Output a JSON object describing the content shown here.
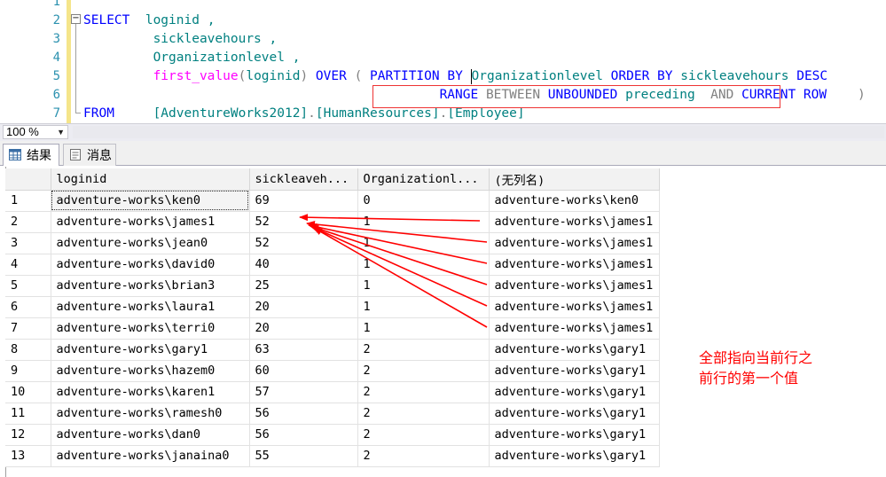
{
  "editor": {
    "line_numbers": [
      "1",
      "2",
      "3",
      "4",
      "5",
      "6",
      "7"
    ],
    "lines": [
      {
        "num": "1",
        "tokens": []
      },
      {
        "num": "2",
        "tokens": [
          {
            "t": "SELECT",
            "c": "kw"
          },
          {
            "t": "  loginid ,",
            "c": "id"
          }
        ]
      },
      {
        "num": "3",
        "tokens": [
          {
            "t": "         sickleavehours ,",
            "c": "id"
          }
        ]
      },
      {
        "num": "4",
        "tokens": [
          {
            "t": "         Organizationlevel ,",
            "c": "id"
          }
        ]
      },
      {
        "num": "5",
        "tokens": [
          {
            "t": "         first_value",
            "c": "fn"
          },
          {
            "t": "(",
            "c": "gr"
          },
          {
            "t": "loginid",
            "c": "id"
          },
          {
            "t": ")",
            "c": "gr"
          },
          {
            "t": " OVER ",
            "c": "kw"
          },
          {
            "t": "( ",
            "c": "gr"
          },
          {
            "t": "PARTITION BY ",
            "c": "kw"
          },
          {
            "t": "|",
            "c": "cursor"
          },
          {
            "t": "Organizationlevel",
            "c": "id"
          },
          {
            "t": " ORDER BY ",
            "c": "kw"
          },
          {
            "t": "sickleavehours",
            "c": "id"
          },
          {
            "t": " DESC",
            "c": "kw"
          }
        ]
      },
      {
        "num": "6",
        "tokens": [
          {
            "t": "                                              RANGE ",
            "c": "kw"
          },
          {
            "t": "BETWEEN ",
            "c": "gr"
          },
          {
            "t": "UNBOUNDED ",
            "c": "kw"
          },
          {
            "t": "preceding  ",
            "c": "id"
          },
          {
            "t": "AND ",
            "c": "gr"
          },
          {
            "t": "CURRENT ROW",
            "c": "kw"
          },
          {
            "t": "    )",
            "c": "gr"
          }
        ]
      },
      {
        "num": "7",
        "tokens": [
          {
            "t": "FROM",
            "c": "kw"
          },
          {
            "t": "     [AdventureWorks2012]",
            "c": "id"
          },
          {
            "t": ".",
            "c": "gr"
          },
          {
            "t": "[HumanResources]",
            "c": "id"
          },
          {
            "t": ".",
            "c": "gr"
          },
          {
            "t": "[Employee]",
            "c": "id"
          }
        ]
      }
    ]
  },
  "statusbar": {
    "zoom": "100 %"
  },
  "tabs": [
    {
      "label": "结果",
      "icon": "grid-icon",
      "active": true
    },
    {
      "label": "消息",
      "icon": "message-icon",
      "active": false
    }
  ],
  "grid": {
    "columns": [
      "loginid",
      "sickleaveh...",
      "Organizationl...",
      "(无列名)"
    ],
    "rows": [
      [
        "1",
        "adventure-works\\ken0",
        "69",
        "0",
        "adventure-works\\ken0"
      ],
      [
        "2",
        "adventure-works\\james1",
        "52",
        "1",
        "adventure-works\\james1"
      ],
      [
        "3",
        "adventure-works\\jean0",
        "52",
        "1",
        "adventure-works\\james1"
      ],
      [
        "4",
        "adventure-works\\david0",
        "40",
        "1",
        "adventure-works\\james1"
      ],
      [
        "5",
        "adventure-works\\brian3",
        "25",
        "1",
        "adventure-works\\james1"
      ],
      [
        "6",
        "adventure-works\\laura1",
        "20",
        "1",
        "adventure-works\\james1"
      ],
      [
        "7",
        "adventure-works\\terri0",
        "20",
        "1",
        "adventure-works\\james1"
      ],
      [
        "8",
        "adventure-works\\gary1",
        "63",
        "2",
        "adventure-works\\gary1"
      ],
      [
        "9",
        "adventure-works\\hazem0",
        "60",
        "2",
        "adventure-works\\gary1"
      ],
      [
        "10",
        "adventure-works\\karen1",
        "57",
        "2",
        "adventure-works\\gary1"
      ],
      [
        "11",
        "adventure-works\\ramesh0",
        "56",
        "2",
        "adventure-works\\gary1"
      ],
      [
        "12",
        "adventure-works\\dan0",
        "56",
        "2",
        "adventure-works\\gary1"
      ],
      [
        "13",
        "adventure-works\\janaina0",
        "55",
        "2",
        "adventure-works\\gary1"
      ]
    ]
  },
  "annotation": {
    "text": "全部指向当前行之前行的第一个值",
    "color": "#ff0000"
  }
}
